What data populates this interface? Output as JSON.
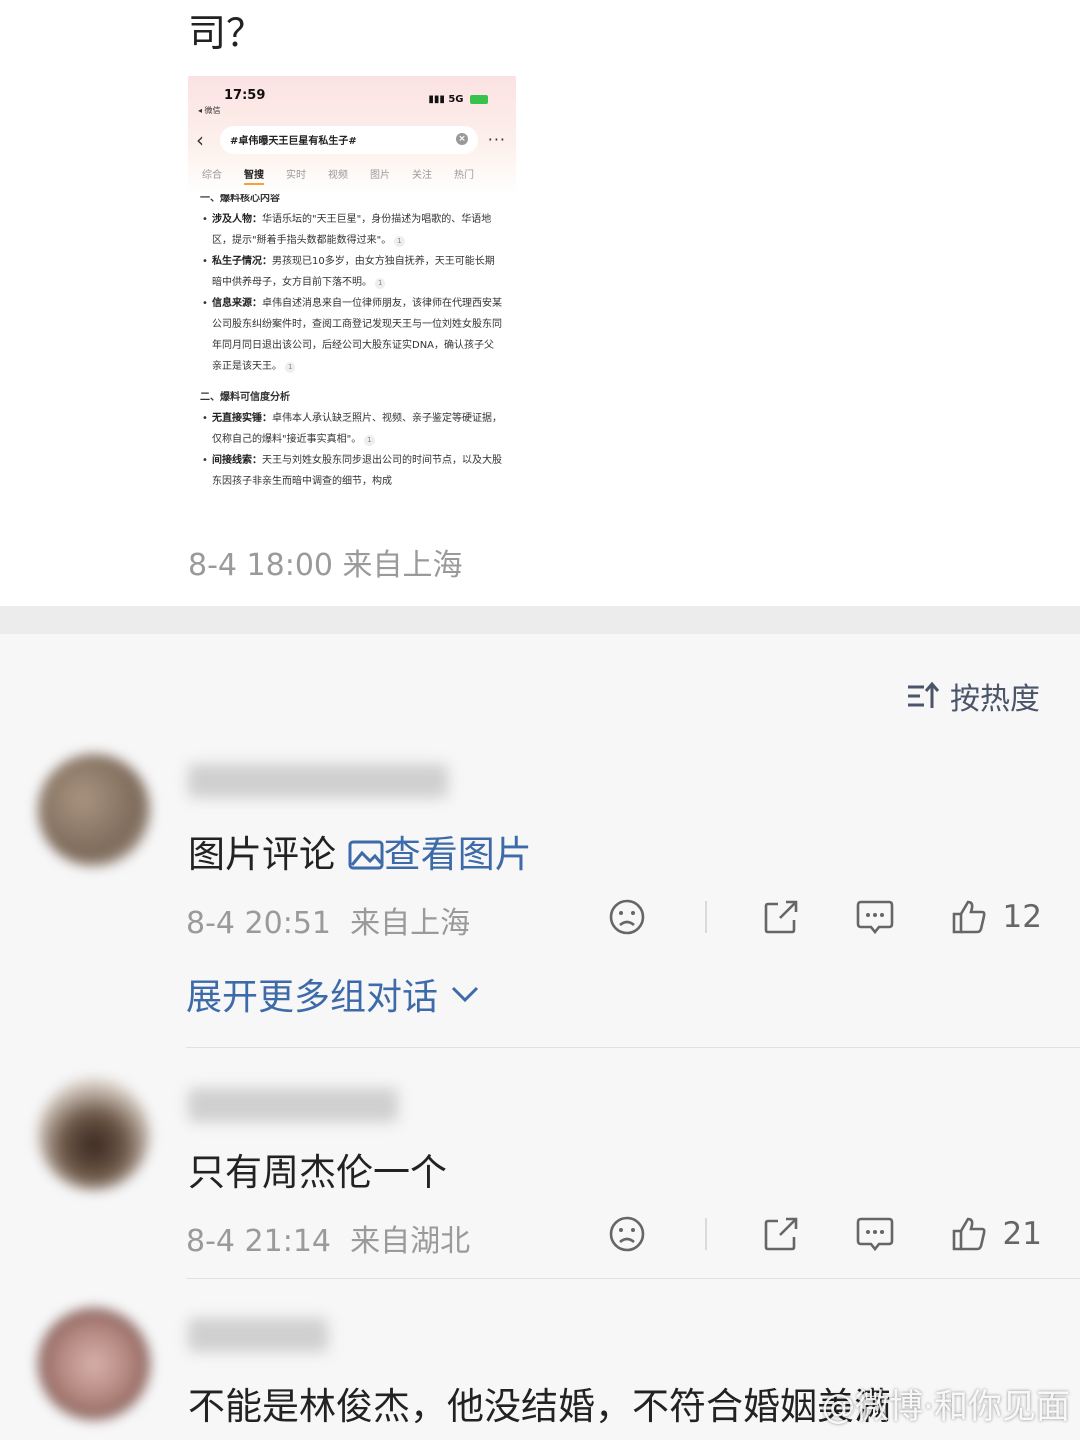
{
  "post": {
    "text_tail": "司？",
    "meta": "8-4 18:00  来自上海",
    "screenshot": {
      "time": "17:59",
      "back_app": "◂ 微信",
      "network": "5G",
      "search_query": "#卓伟曝天王巨星有私生子#",
      "tabs": [
        "综合",
        "智搜",
        "实时",
        "视频",
        "图片",
        "关注",
        "热门"
      ],
      "active_tab": "智搜",
      "section1": "一、爆料核心内容",
      "items1": [
        {
          "label": "涉及人物：",
          "text": "华语乐坛的\"天王巨星\"，身份描述为唱歌的、华语地区，提示\"掰着手指头数都能数得过来\"。",
          "cite": "1"
        },
        {
          "label": "私生子情况：",
          "text": "男孩现已10多岁，由女方独自抚养，天王可能长期暗中供养母子，女方目前下落不明。",
          "cite": "1"
        },
        {
          "label": "信息来源：",
          "text": "卓伟自述消息来自一位律师朋友，该律师在代理西安某公司股东纠纷案件时，查阅工商登记发现天王与一位刘姓女股东同年同月同日退出该公司，后经公司大股东证实DNA，确认孩子父亲正是该天王。",
          "cite": "1"
        }
      ],
      "section2": "二、爆料可信度分析",
      "items2": [
        {
          "label": "无直接实锤：",
          "text": "卓伟本人承认缺乏照片、视频、亲子鉴定等硬证据，仅称自己的爆料\"接近事实真相\"。",
          "cite": "1"
        },
        {
          "label": "间接线索：",
          "text": "天王与刘姓女股东同步退出公司的时间节点，以及大股东因孩子非亲生而暗中调查的细节，构成",
          "cite": ""
        }
      ]
    }
  },
  "sort_label": "按热度",
  "comments": [
    {
      "text": "图片评论",
      "image_link": "查看图片",
      "time": "8-4 20:51",
      "location": "来自上海",
      "likes": "12",
      "expand": "展开更多组对话"
    },
    {
      "text": "只有周杰伦一个",
      "time": "8-4 21:14",
      "location": "来自湖北",
      "likes": "21"
    },
    {
      "text": "不能是林俊杰，他没结婚，不符合婚姻美满"
    }
  ],
  "watermark": "@微博·和你见面",
  "colors": {
    "link": "#3d6aa8",
    "meta": "#9a9a9a",
    "divider": "#ececec"
  }
}
